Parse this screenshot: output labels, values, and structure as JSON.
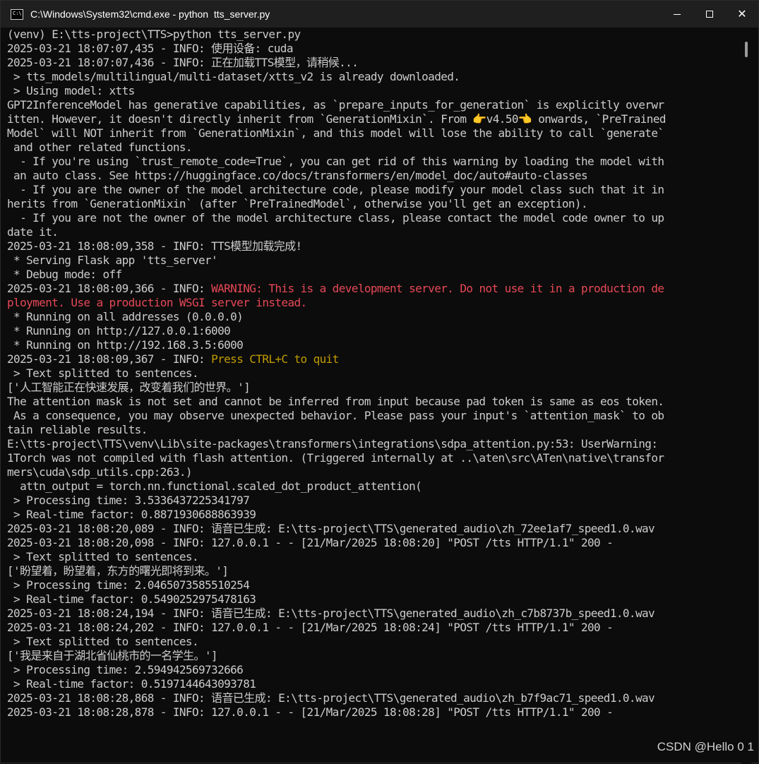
{
  "window": {
    "title": "C:\\Windows\\System32\\cmd.exe - python  tts_server.py",
    "icon_label": "C:\\"
  },
  "controls": {
    "minimize": "minimize",
    "maximize": "maximize",
    "close": "close"
  },
  "console": {
    "lines": [
      {
        "t": "(venv) E:\\tts-project\\TTS>python tts_server.py"
      },
      {
        "t": "2025-03-21 18:07:07,435 - INFO: 使用设备: cuda"
      },
      {
        "t": "2025-03-21 18:07:07,436 - INFO: 正在加载TTS模型，请稍候..."
      },
      {
        "t": " > tts_models/multilingual/multi-dataset/xtts_v2 is already downloaded."
      },
      {
        "t": " > Using model: xtts"
      },
      {
        "t": "GPT2InferenceModel has generative capabilities, as `prepare_inputs_for_generation` is explicitly overwr"
      },
      {
        "t": "itten. However, it doesn't directly inherit from `GenerationMixin`. From 👉v4.50👈 onwards, `PreTrained"
      },
      {
        "t": "Model` will NOT inherit from `GenerationMixin`, and this model will lose the ability to call `generate`"
      },
      {
        "t": " and other related functions."
      },
      {
        "t": "  - If you're using `trust_remote_code=True`, you can get rid of this warning by loading the model with"
      },
      {
        "t": " an auto class. See https://huggingface.co/docs/transformers/en/model_doc/auto#auto-classes"
      },
      {
        "t": "  - If you are the owner of the model architecture code, please modify your model class such that it in"
      },
      {
        "t": "herits from `GenerationMixin` (after `PreTrainedModel`, otherwise you'll get an exception)."
      },
      {
        "t": "  - If you are not the owner of the model architecture class, please contact the model code owner to up"
      },
      {
        "t": "date it."
      },
      {
        "t": "2025-03-21 18:08:09,358 - INFO: TTS模型加载完成!"
      },
      {
        "t": " * Serving Flask app 'tts_server'"
      },
      {
        "t": " * Debug mode: off"
      },
      {
        "t": "2025-03-21 18:08:09,366 - INFO: ",
        "w": "WARNING: This is a development server. Do not use it in a production de"
      },
      {
        "t": "",
        "w": "ployment. Use a production WSGI server instead."
      },
      {
        "t": " * Running on all addresses (0.0.0.0)"
      },
      {
        "t": " * Running on http://127.0.0.1:6000"
      },
      {
        "t": " * Running on http://192.168.3.5:6000"
      },
      {
        "t": "2025-03-21 18:08:09,367 - INFO: ",
        "q": "Press CTRL+C to quit"
      },
      {
        "t": " > Text splitted to sentences."
      },
      {
        "t": "['人工智能正在快速发展，改变着我们的世界。']"
      },
      {
        "t": "The attention mask is not set and cannot be inferred from input because pad token is same as eos token."
      },
      {
        "t": " As a consequence, you may observe unexpected behavior. Please pass your input's `attention_mask` to ob"
      },
      {
        "t": "tain reliable results."
      },
      {
        "t": "E:\\tts-project\\TTS\\venv\\Lib\\site-packages\\transformers\\integrations\\sdpa_attention.py:53: UserWarning:"
      },
      {
        "t": "1Torch was not compiled with flash attention. (Triggered internally at ..\\aten\\src\\ATen\\native\\transfor"
      },
      {
        "t": "mers\\cuda\\sdp_utils.cpp:263.)"
      },
      {
        "t": "  attn_output = torch.nn.functional.scaled_dot_product_attention("
      },
      {
        "t": " > Processing time: 3.5336437225341797"
      },
      {
        "t": " > Real-time factor: 0.8871930688863939"
      },
      {
        "t": "2025-03-21 18:08:20,089 - INFO: 语音已生成: E:\\tts-project\\TTS\\generated_audio\\zh_72ee1af7_speed1.0.wav"
      },
      {
        "t": "2025-03-21 18:08:20,098 - INFO: 127.0.0.1 - - [21/Mar/2025 18:08:20] \"POST /tts HTTP/1.1\" 200 -"
      },
      {
        "t": " > Text splitted to sentences."
      },
      {
        "t": "['盼望着，盼望着，东方的曙光即将到来。']"
      },
      {
        "t": " > Processing time: 2.0465073585510254"
      },
      {
        "t": " > Real-time factor: 0.5490252975478163"
      },
      {
        "t": "2025-03-21 18:08:24,194 - INFO: 语音已生成: E:\\tts-project\\TTS\\generated_audio\\zh_c7b8737b_speed1.0.wav"
      },
      {
        "t": "2025-03-21 18:08:24,202 - INFO: 127.0.0.1 - - [21/Mar/2025 18:08:24] \"POST /tts HTTP/1.1\" 200 -"
      },
      {
        "t": " > Text splitted to sentences."
      },
      {
        "t": "['我是来自于湖北省仙桃市的一名学生。']"
      },
      {
        "t": " > Processing time: 2.594942569732666"
      },
      {
        "t": " > Real-time factor: 0.5197144643093781"
      },
      {
        "t": "2025-03-21 18:08:28,868 - INFO: 语音已生成: E:\\tts-project\\TTS\\generated_audio\\zh_b7f9ac71_speed1.0.wav"
      },
      {
        "t": "2025-03-21 18:08:28,878 - INFO: 127.0.0.1 - - [21/Mar/2025 18:08:28] \"POST /tts HTTP/1.1\" 200 -"
      },
      {
        "t": ""
      }
    ]
  },
  "watermark": "CSDN @Hello 0 1",
  "colors": {
    "background": "#0c0c0c",
    "text": "#cccccc",
    "warning": "#e74856",
    "quit_hint": "#c19c00",
    "titlebar": "#1f1f1f"
  }
}
